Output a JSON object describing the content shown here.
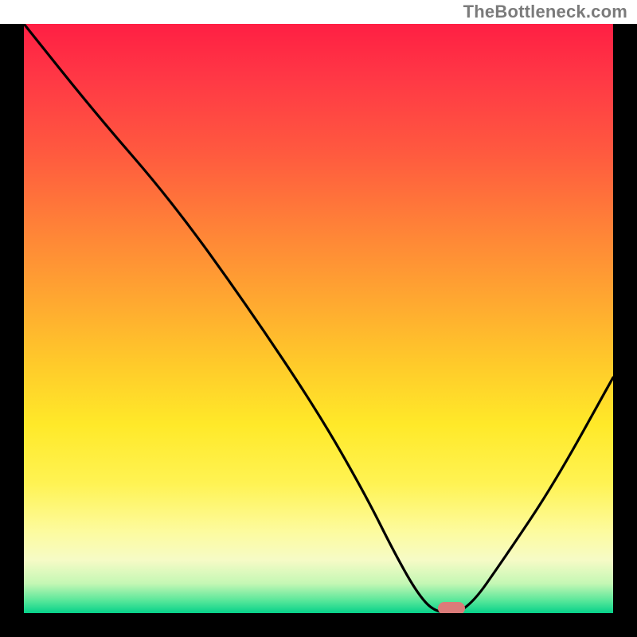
{
  "watermark": "TheBottleneck.com",
  "chart_data": {
    "type": "line",
    "title": "",
    "xlabel": "",
    "ylabel": "",
    "xlim": [
      0,
      100
    ],
    "ylim": [
      0,
      100
    ],
    "grid": false,
    "legend": false,
    "series": [
      {
        "name": "curve",
        "color": "#000000",
        "x": [
          0,
          12,
          25,
          38,
          50,
          58,
          63,
          67,
          70,
          75,
          82,
          90,
          100
        ],
        "values": [
          100,
          85,
          70,
          52,
          34,
          20,
          10,
          3,
          0,
          0,
          10,
          22,
          40
        ]
      }
    ],
    "marker": {
      "x": 72.5,
      "y": 0.8,
      "color": "#db7b79"
    },
    "background_gradient": {
      "stops": [
        {
          "pos": 0.0,
          "color": "#ff1f44"
        },
        {
          "pos": 0.5,
          "color": "#ffb030"
        },
        {
          "pos": 0.78,
          "color": "#fff353"
        },
        {
          "pos": 0.95,
          "color": "#c4f7b4"
        },
        {
          "pos": 1.0,
          "color": "#06d18a"
        }
      ]
    }
  }
}
